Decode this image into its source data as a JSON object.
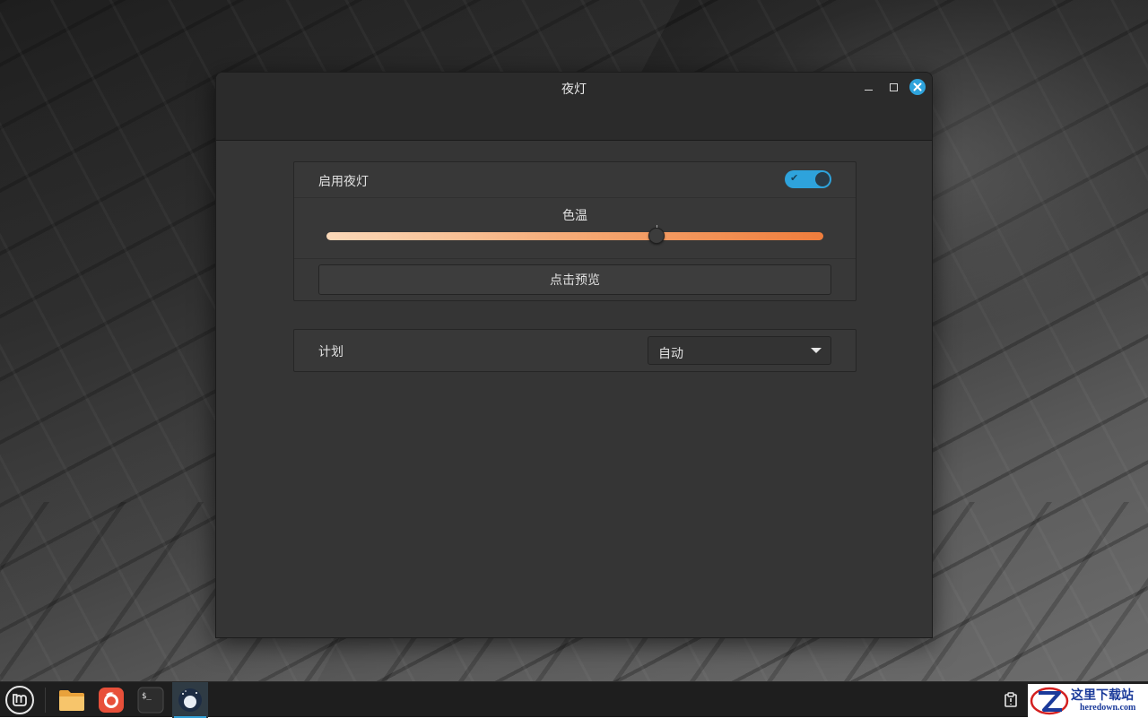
{
  "window": {
    "title": "夜灯"
  },
  "night_light": {
    "enable_label": "启用夜灯",
    "enabled": true,
    "color_temperature": {
      "label": "色温",
      "value_fraction": 0.665,
      "default_mark_fraction": 0.665
    },
    "preview_button_label": "点击预览"
  },
  "schedule": {
    "label": "计划",
    "selected": "自动"
  },
  "taskbar": {
    "items": [
      {
        "name": "menu-button",
        "icon": "linux-mint-logo"
      },
      {
        "name": "files",
        "icon": "folder-icon"
      },
      {
        "name": "firefox",
        "icon": "firefox-icon"
      },
      {
        "name": "terminal",
        "icon": "terminal-icon"
      },
      {
        "name": "night-light",
        "icon": "night-light-icon",
        "active": true
      }
    ],
    "tray_icon": "notes-icon",
    "terminal_glyph": "$_"
  },
  "watermark": {
    "text_cn": "这里下载站",
    "text_en": "heredown.com"
  },
  "colors": {
    "accent": "#2ea3dc",
    "slider_start": "#fbd9b9",
    "slider_end": "#ef7d3c",
    "window_bg": "#353535"
  }
}
